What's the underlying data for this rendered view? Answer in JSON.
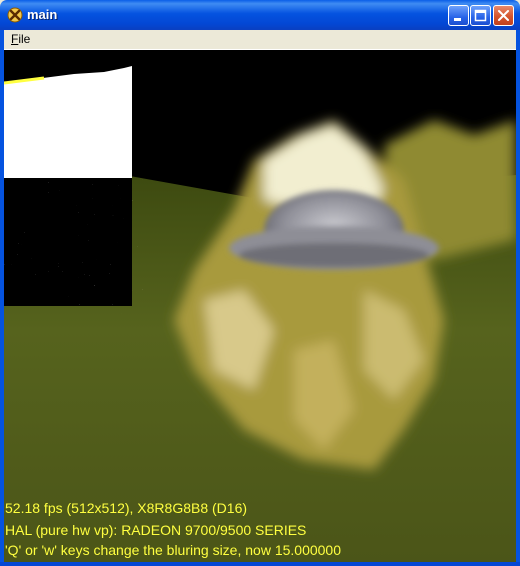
{
  "window": {
    "title": "main",
    "icon": "directx-x-icon"
  },
  "title_buttons": {
    "minimize": "minimize-icon",
    "maximize": "maximize-icon",
    "close": "close-icon"
  },
  "menu": {
    "items": [
      {
        "label": "File",
        "mnemonic": "F"
      }
    ]
  },
  "hud": {
    "line1": "52.18 fps (512x512), X8R8G8B8 (D16)",
    "line2": "HAL (pure hw vp): RADEON 9700/9500 SERIES",
    "line3": "'Q' or 'w' keys change the bluring size, now 15.000000"
  },
  "colors": {
    "titlebar": "#0553e0",
    "hud_text": "#ffff40",
    "menubar": "#ece9d8",
    "terrain_green": "#4b5a14",
    "terrain_yellow": "#b8a040"
  }
}
